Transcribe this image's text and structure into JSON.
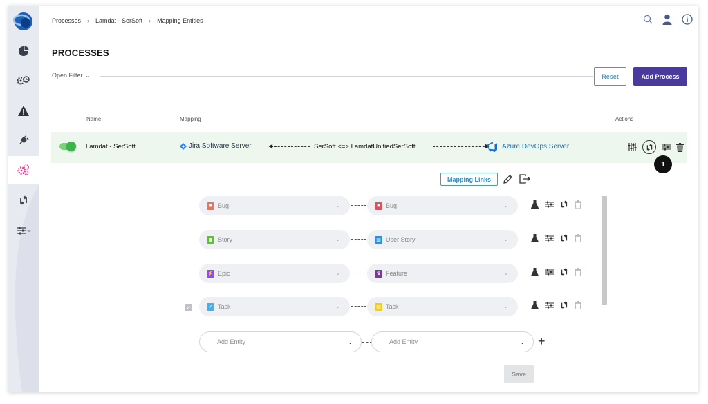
{
  "breadcrumb": [
    "Processes",
    "Lamdat - SerSoft",
    "Mapping Entities"
  ],
  "page_title": "PROCESSES",
  "filter": {
    "label": "Open Filter"
  },
  "buttons": {
    "reset": "Reset",
    "add_process": "Add Process",
    "mapping_links": "Mapping Links",
    "save": "Save"
  },
  "table": {
    "headers": {
      "name": "Name",
      "mapping": "Mapping",
      "actions": "Actions"
    }
  },
  "process": {
    "name": "Lamdat - SerSoft",
    "enabled": true,
    "left_system": "Jira Software Server",
    "mapping_name": "SerSoft <=> LamdatUnifiedSerSoft",
    "right_system": "Azure DevOps Server"
  },
  "callout_badge": "1",
  "entities": [
    {
      "left": "Bug",
      "left_icon": "bug-icon",
      "left_color": "#e8735f",
      "right": "Bug",
      "right_icon": "bug-icon",
      "right_color": "#d9535f",
      "checked": false
    },
    {
      "left": "Story",
      "left_icon": "story-icon",
      "left_color": "#63ba3c",
      "right": "User Story",
      "right_icon": "book-icon",
      "right_color": "#2f8ddb",
      "checked": false
    },
    {
      "left": "Epic",
      "left_icon": "epic-icon",
      "left_color": "#904ee2",
      "right": "Feature",
      "right_icon": "trophy-icon",
      "right_color": "#773b93",
      "checked": false
    },
    {
      "left": "Task",
      "left_icon": "task-icon",
      "left_color": "#4bade8",
      "right": "Task",
      "right_icon": "task-clipboard-icon",
      "right_color": "#f2cb1d",
      "checked": true
    }
  ],
  "add_entity": {
    "left_placeholder": "Add Entity",
    "right_placeholder": "Add Entity"
  }
}
